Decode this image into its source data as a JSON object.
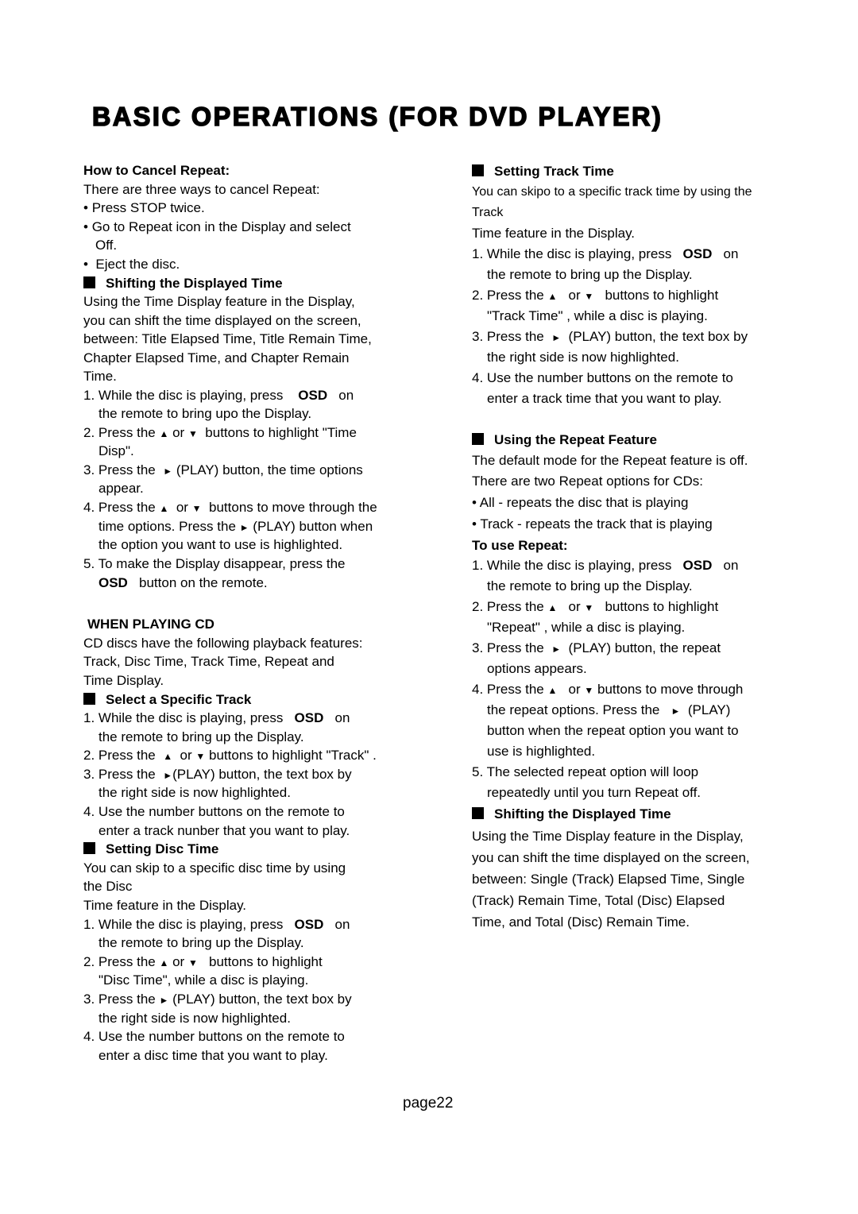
{
  "page": {
    "title": "BASIC OPERATIONS (FOR DVD PLAYER)",
    "page_number": "page22"
  },
  "left": {
    "cancel_repeat": {
      "heading": "How to Cancel Repeat:",
      "intro": "There are three ways to cancel Repeat:",
      "bullets": [
        "Press STOP twice.",
        "Go to Repeat icon in the Display and select",
        "Off.",
        "Eject the disc."
      ]
    },
    "shifting_time": {
      "heading": "Shifting the Displayed Time",
      "para": [
        "Using the Time Display feature in the Display,",
        "you can shift the time displayed on the screen,",
        "between: Title Elapsed Time, Title Remain Time,",
        "Chapter Elapsed Time, and Chapter Remain",
        "Time."
      ],
      "steps": [
        {
          "num": "1.",
          "pre": "While the disc is playing, press",
          "key": "OSD",
          "post": "on",
          "cont": "the remote to bring upo the Display."
        },
        {
          "num": "2.",
          "pre": "Press the",
          "up": "▲",
          "or": "or",
          "down": "▼",
          "post": "buttons to highlight \"Time",
          "cont": "Disp\"."
        },
        {
          "num": "3.",
          "pre": "Press the",
          "play": "►",
          "post": "(PLAY) button, the time options",
          "cont": "appear."
        },
        {
          "num": "4.",
          "pre": "Press the",
          "up": "▲",
          "or": "or",
          "down": "▼",
          "post": "buttons to move through the",
          "cont1_pre": "time options. Press the",
          "play": "►",
          "cont1_post": "(PLAY) button when",
          "cont2": "the option you want to use is highlighted."
        },
        {
          "num": "5.",
          "pre": "To make the Display disappear, press the",
          "key": "OSD",
          "cont": "button on the remote."
        }
      ]
    },
    "when_playing_cd": {
      "heading": "WHEN PLAYING CD",
      "para": [
        "CD discs have the following playback features:",
        "Track, Disc Time, Track Time, Repeat and",
        "Time Display."
      ]
    },
    "select_track": {
      "heading": "Select a Specific Track",
      "steps": [
        {
          "num": "1.",
          "pre": "While the disc is playing, press",
          "key": "OSD",
          "post": "on",
          "cont": "the remote to bring up the Display."
        },
        {
          "num": "2.",
          "pre": "Press the",
          "up": "▲",
          "or": "or",
          "down": "▼",
          "post": "buttons to highlight \"Track\" ."
        },
        {
          "num": "3.",
          "pre": "Press the",
          "play": "►",
          "post": "(PLAY) button, the text box by",
          "cont": "the right side is now highlighted."
        },
        {
          "num": "4.",
          "pre": "Use the number buttons on the remote to",
          "cont": "enter a track nunber that you want to play."
        }
      ]
    },
    "disc_time": {
      "heading": "Setting Disc Time",
      "para": [
        "You can skip to a specific disc time by using",
        "the Disc",
        "Time feature in the Display."
      ],
      "steps": [
        {
          "num": "1.",
          "pre": "While the disc is playing, press",
          "key": "OSD",
          "post": "on",
          "cont": "the remote to bring up the Display."
        },
        {
          "num": "2.",
          "pre": "Press the",
          "up": "▲",
          "or": "or",
          "down": "▼",
          "post": "buttons to highlight",
          "cont": "\"Disc Time\", while a disc is playing."
        },
        {
          "num": "3.",
          "pre": "Press the",
          "play": "►",
          "post": "(PLAY) button, the text box by",
          "cont": "the right side is now highlighted."
        },
        {
          "num": "4.",
          "pre": "Use the number buttons on the remote to",
          "cont": "enter a disc time that you want to play."
        }
      ]
    }
  },
  "right": {
    "track_time": {
      "heading": "Setting Track Time",
      "para": [
        "You can skipo to a specific track time by using the",
        "Track",
        "Time feature in the Display."
      ],
      "steps": [
        {
          "num": "1.",
          "pre": "While the disc is playing, press",
          "key": "OSD",
          "post": "on",
          "cont": "the remote to bring up the Display."
        },
        {
          "num": "2.",
          "pre": "Press the",
          "up": "▲",
          "or": "or",
          "down": "▼",
          "post": "buttons to highlight",
          "cont": "\"Track Time\" , while a disc is playing."
        },
        {
          "num": "3.",
          "pre": "Press the",
          "play": "►",
          "post": "(PLAY) button, the text box by",
          "cont": "the right side is now highlighted."
        },
        {
          "num": "4.",
          "pre": "Use the number buttons on the remote to",
          "cont": "enter a track time that you want to play."
        }
      ]
    },
    "repeat_feature": {
      "heading": "Using the Repeat Feature",
      "para": [
        "The default mode for the Repeat feature is off.",
        "There are two Repeat options for CDs:"
      ],
      "bullets": [
        "All - repeats the disc that is playing",
        "Track - repeats the track that is playing"
      ],
      "subheading": "To use Repeat:",
      "steps": [
        {
          "num": "1.",
          "pre": "While the disc is playing, press",
          "key": "OSD",
          "post": "on",
          "cont": "the remote to bring up the Display."
        },
        {
          "num": "2.",
          "pre": "Press the",
          "up": "▲",
          "or": "or",
          "down": "▼",
          "post": "buttons to highlight",
          "cont": "\"Repeat\" , while a disc is playing."
        },
        {
          "num": "3.",
          "pre": "Press the",
          "play": "►",
          "post": "(PLAY) button, the repeat",
          "cont": "options appears."
        },
        {
          "num": "4.",
          "pre": "Press the",
          "up": "▲",
          "or": "or",
          "down": "▼",
          "post": "buttons to move through",
          "cont1_pre": "the repeat options. Press the",
          "play": "►",
          "cont1_post": "(PLAY)",
          "cont2": "button when the repeat option you want to",
          "cont3": "use is highlighted."
        },
        {
          "num": "5.",
          "pre": "The selected repeat option will loop",
          "cont": "repeatedly until you turn Repeat off."
        }
      ]
    },
    "shifting_time": {
      "heading": "Shifting the Displayed Time",
      "para": [
        "Using the Time Display feature in the Display,",
        "you can shift the time displayed on the screen,",
        "between: Single (Track) Elapsed Time, Single",
        "(Track) Remain Time, Total (Disc) Elapsed",
        "Time, and Total (Disc) Remain Time."
      ]
    }
  }
}
